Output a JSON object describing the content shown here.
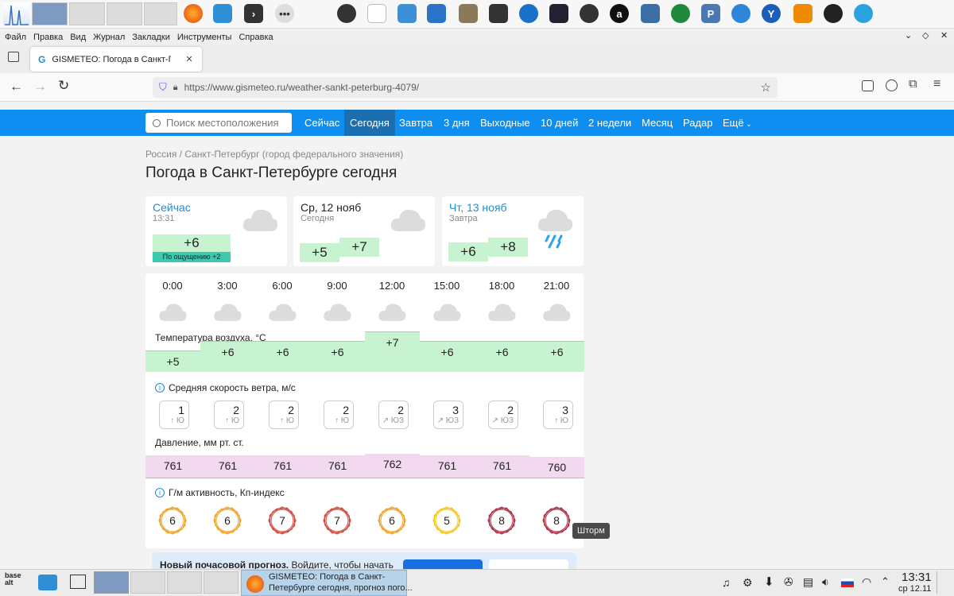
{
  "browser": {
    "menu": [
      "Файл",
      "Правка",
      "Вид",
      "Журнал",
      "Закладки",
      "Инструменты",
      "Справка"
    ],
    "tab_title": "GISMETEO: Погода в Санкт-Пет",
    "url": "https://www.gismeteo.ru/weather-sankt-peterburg-4079/"
  },
  "site": {
    "search_placeholder": "Поиск местоположения",
    "nav": [
      "Сейчас",
      "Сегодня",
      "Завтра",
      "3 дня",
      "Выходные",
      "10 дней",
      "2 недели",
      "Месяц",
      "Радар",
      "Ещё"
    ],
    "active_nav_index": 1,
    "breadcrumb": "Россия / Санкт-Петербург (город федерального значения)",
    "page_title": "Погода в Санкт-Петербурге сегодня",
    "now_card": {
      "title": "Сейчас",
      "time": "13:31",
      "temp": "+6",
      "feels": "По ощущению +2"
    },
    "today_card": {
      "title": "Ср, 12 нояб",
      "sub": "Сегодня",
      "t_min": "+5",
      "t_max": "+7"
    },
    "tomorrow_card": {
      "title": "Чт, 13 нояб",
      "sub": "Завтра",
      "t_min": "+6",
      "t_max": "+8"
    },
    "hours": [
      "0:00",
      "3:00",
      "6:00",
      "9:00",
      "12:00",
      "15:00",
      "18:00",
      "21:00"
    ],
    "temp_label": "Температура воздуха, °C",
    "temps": [
      "+5",
      "+6",
      "+6",
      "+6",
      "+7",
      "+6",
      "+6",
      "+6"
    ],
    "temp_values": [
      5,
      6,
      6,
      6,
      7,
      6,
      6,
      6
    ],
    "wind_label": "Средняя скорость ветра, м/с",
    "wind": [
      {
        "v": "1",
        "d": "↑ Ю"
      },
      {
        "v": "2",
        "d": "↑ Ю"
      },
      {
        "v": "2",
        "d": "↑ Ю"
      },
      {
        "v": "2",
        "d": "↑ Ю"
      },
      {
        "v": "2",
        "d": "↗ ЮЗ"
      },
      {
        "v": "3",
        "d": "↗ ЮЗ"
      },
      {
        "v": "2",
        "d": "↗ ЮЗ"
      },
      {
        "v": "3",
        "d": "↑ Ю"
      }
    ],
    "pressure_label": "Давление, мм рт. ст.",
    "pressure": [
      "761",
      "761",
      "761",
      "761",
      "762",
      "761",
      "761",
      "760"
    ],
    "pressure_values": [
      761,
      761,
      761,
      761,
      762,
      761,
      761,
      760
    ],
    "kp_label": "Г/м активность, Кп-индекс",
    "kp": [
      "6",
      "6",
      "7",
      "7",
      "6",
      "5",
      "8",
      "8"
    ],
    "kp_colors": [
      "#f0a020",
      "#f0a020",
      "#d0453a",
      "#d0453a",
      "#f0a020",
      "#f5c518",
      "#b02a40",
      "#b02a40"
    ],
    "tooltip": "Шторм",
    "promo_bold": "Новый почасовой прогноз.",
    "promo_text": " Войдите, чтобы начать"
  },
  "taskbar": {
    "window_title_1": "GISMETEO: Погода в Санкт-",
    "window_title_2": "Петербурге сегодня, прогноз пого...",
    "clock_time": "13:31",
    "clock_date": "ср 12.11"
  },
  "colors": {
    "accent": "#0d8ef0",
    "temp_green": "#c7f3d1",
    "pressure_pink": "#f3d9f0",
    "link": "#1b8fd6"
  }
}
